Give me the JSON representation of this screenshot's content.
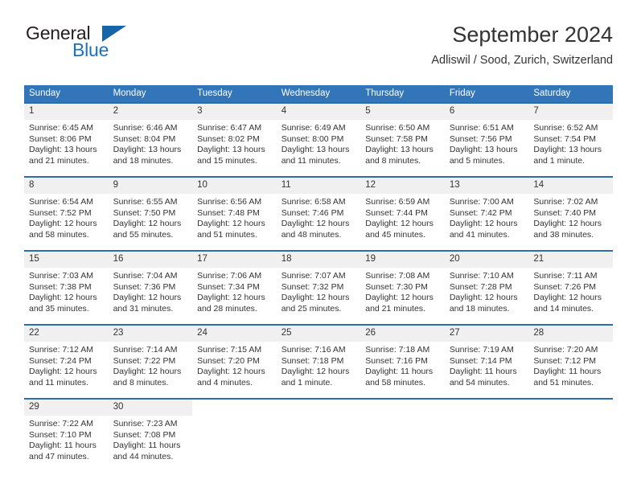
{
  "brand": {
    "name_part1": "General",
    "name_part2": "Blue",
    "logo_icon": "triangle-logo-icon"
  },
  "header": {
    "title": "September 2024",
    "subtitle": "Adliswil / Sood, Zurich, Switzerland"
  },
  "colors": {
    "header_blue": "#3275b8",
    "row_border_blue": "#2e6da8",
    "daynum_band": "#f0f0f0",
    "brand_blue": "#1b72b8",
    "text": "#333333"
  },
  "weekday_headers": [
    "Sunday",
    "Monday",
    "Tuesday",
    "Wednesday",
    "Thursday",
    "Friday",
    "Saturday"
  ],
  "weeks": [
    [
      {
        "day": "1",
        "sunrise": "Sunrise: 6:45 AM",
        "sunset": "Sunset: 8:06 PM",
        "daylight_line1": "Daylight: 13 hours",
        "daylight_line2": "and 21 minutes."
      },
      {
        "day": "2",
        "sunrise": "Sunrise: 6:46 AM",
        "sunset": "Sunset: 8:04 PM",
        "daylight_line1": "Daylight: 13 hours",
        "daylight_line2": "and 18 minutes."
      },
      {
        "day": "3",
        "sunrise": "Sunrise: 6:47 AM",
        "sunset": "Sunset: 8:02 PM",
        "daylight_line1": "Daylight: 13 hours",
        "daylight_line2": "and 15 minutes."
      },
      {
        "day": "4",
        "sunrise": "Sunrise: 6:49 AM",
        "sunset": "Sunset: 8:00 PM",
        "daylight_line1": "Daylight: 13 hours",
        "daylight_line2": "and 11 minutes."
      },
      {
        "day": "5",
        "sunrise": "Sunrise: 6:50 AM",
        "sunset": "Sunset: 7:58 PM",
        "daylight_line1": "Daylight: 13 hours",
        "daylight_line2": "and 8 minutes."
      },
      {
        "day": "6",
        "sunrise": "Sunrise: 6:51 AM",
        "sunset": "Sunset: 7:56 PM",
        "daylight_line1": "Daylight: 13 hours",
        "daylight_line2": "and 5 minutes."
      },
      {
        "day": "7",
        "sunrise": "Sunrise: 6:52 AM",
        "sunset": "Sunset: 7:54 PM",
        "daylight_line1": "Daylight: 13 hours",
        "daylight_line2": "and 1 minute."
      }
    ],
    [
      {
        "day": "8",
        "sunrise": "Sunrise: 6:54 AM",
        "sunset": "Sunset: 7:52 PM",
        "daylight_line1": "Daylight: 12 hours",
        "daylight_line2": "and 58 minutes."
      },
      {
        "day": "9",
        "sunrise": "Sunrise: 6:55 AM",
        "sunset": "Sunset: 7:50 PM",
        "daylight_line1": "Daylight: 12 hours",
        "daylight_line2": "and 55 minutes."
      },
      {
        "day": "10",
        "sunrise": "Sunrise: 6:56 AM",
        "sunset": "Sunset: 7:48 PM",
        "daylight_line1": "Daylight: 12 hours",
        "daylight_line2": "and 51 minutes."
      },
      {
        "day": "11",
        "sunrise": "Sunrise: 6:58 AM",
        "sunset": "Sunset: 7:46 PM",
        "daylight_line1": "Daylight: 12 hours",
        "daylight_line2": "and 48 minutes."
      },
      {
        "day": "12",
        "sunrise": "Sunrise: 6:59 AM",
        "sunset": "Sunset: 7:44 PM",
        "daylight_line1": "Daylight: 12 hours",
        "daylight_line2": "and 45 minutes."
      },
      {
        "day": "13",
        "sunrise": "Sunrise: 7:00 AM",
        "sunset": "Sunset: 7:42 PM",
        "daylight_line1": "Daylight: 12 hours",
        "daylight_line2": "and 41 minutes."
      },
      {
        "day": "14",
        "sunrise": "Sunrise: 7:02 AM",
        "sunset": "Sunset: 7:40 PM",
        "daylight_line1": "Daylight: 12 hours",
        "daylight_line2": "and 38 minutes."
      }
    ],
    [
      {
        "day": "15",
        "sunrise": "Sunrise: 7:03 AM",
        "sunset": "Sunset: 7:38 PM",
        "daylight_line1": "Daylight: 12 hours",
        "daylight_line2": "and 35 minutes."
      },
      {
        "day": "16",
        "sunrise": "Sunrise: 7:04 AM",
        "sunset": "Sunset: 7:36 PM",
        "daylight_line1": "Daylight: 12 hours",
        "daylight_line2": "and 31 minutes."
      },
      {
        "day": "17",
        "sunrise": "Sunrise: 7:06 AM",
        "sunset": "Sunset: 7:34 PM",
        "daylight_line1": "Daylight: 12 hours",
        "daylight_line2": "and 28 minutes."
      },
      {
        "day": "18",
        "sunrise": "Sunrise: 7:07 AM",
        "sunset": "Sunset: 7:32 PM",
        "daylight_line1": "Daylight: 12 hours",
        "daylight_line2": "and 25 minutes."
      },
      {
        "day": "19",
        "sunrise": "Sunrise: 7:08 AM",
        "sunset": "Sunset: 7:30 PM",
        "daylight_line1": "Daylight: 12 hours",
        "daylight_line2": "and 21 minutes."
      },
      {
        "day": "20",
        "sunrise": "Sunrise: 7:10 AM",
        "sunset": "Sunset: 7:28 PM",
        "daylight_line1": "Daylight: 12 hours",
        "daylight_line2": "and 18 minutes."
      },
      {
        "day": "21",
        "sunrise": "Sunrise: 7:11 AM",
        "sunset": "Sunset: 7:26 PM",
        "daylight_line1": "Daylight: 12 hours",
        "daylight_line2": "and 14 minutes."
      }
    ],
    [
      {
        "day": "22",
        "sunrise": "Sunrise: 7:12 AM",
        "sunset": "Sunset: 7:24 PM",
        "daylight_line1": "Daylight: 12 hours",
        "daylight_line2": "and 11 minutes."
      },
      {
        "day": "23",
        "sunrise": "Sunrise: 7:14 AM",
        "sunset": "Sunset: 7:22 PM",
        "daylight_line1": "Daylight: 12 hours",
        "daylight_line2": "and 8 minutes."
      },
      {
        "day": "24",
        "sunrise": "Sunrise: 7:15 AM",
        "sunset": "Sunset: 7:20 PM",
        "daylight_line1": "Daylight: 12 hours",
        "daylight_line2": "and 4 minutes."
      },
      {
        "day": "25",
        "sunrise": "Sunrise: 7:16 AM",
        "sunset": "Sunset: 7:18 PM",
        "daylight_line1": "Daylight: 12 hours",
        "daylight_line2": "and 1 minute."
      },
      {
        "day": "26",
        "sunrise": "Sunrise: 7:18 AM",
        "sunset": "Sunset: 7:16 PM",
        "daylight_line1": "Daylight: 11 hours",
        "daylight_line2": "and 58 minutes."
      },
      {
        "day": "27",
        "sunrise": "Sunrise: 7:19 AM",
        "sunset": "Sunset: 7:14 PM",
        "daylight_line1": "Daylight: 11 hours",
        "daylight_line2": "and 54 minutes."
      },
      {
        "day": "28",
        "sunrise": "Sunrise: 7:20 AM",
        "sunset": "Sunset: 7:12 PM",
        "daylight_line1": "Daylight: 11 hours",
        "daylight_line2": "and 51 minutes."
      }
    ],
    [
      {
        "day": "29",
        "sunrise": "Sunrise: 7:22 AM",
        "sunset": "Sunset: 7:10 PM",
        "daylight_line1": "Daylight: 11 hours",
        "daylight_line2": "and 47 minutes."
      },
      {
        "day": "30",
        "sunrise": "Sunrise: 7:23 AM",
        "sunset": "Sunset: 7:08 PM",
        "daylight_line1": "Daylight: 11 hours",
        "daylight_line2": "and 44 minutes."
      },
      {
        "day": "",
        "sunrise": "",
        "sunset": "",
        "daylight_line1": "",
        "daylight_line2": ""
      },
      {
        "day": "",
        "sunrise": "",
        "sunset": "",
        "daylight_line1": "",
        "daylight_line2": ""
      },
      {
        "day": "",
        "sunrise": "",
        "sunset": "",
        "daylight_line1": "",
        "daylight_line2": ""
      },
      {
        "day": "",
        "sunrise": "",
        "sunset": "",
        "daylight_line1": "",
        "daylight_line2": ""
      },
      {
        "day": "",
        "sunrise": "",
        "sunset": "",
        "daylight_line1": "",
        "daylight_line2": ""
      }
    ]
  ]
}
